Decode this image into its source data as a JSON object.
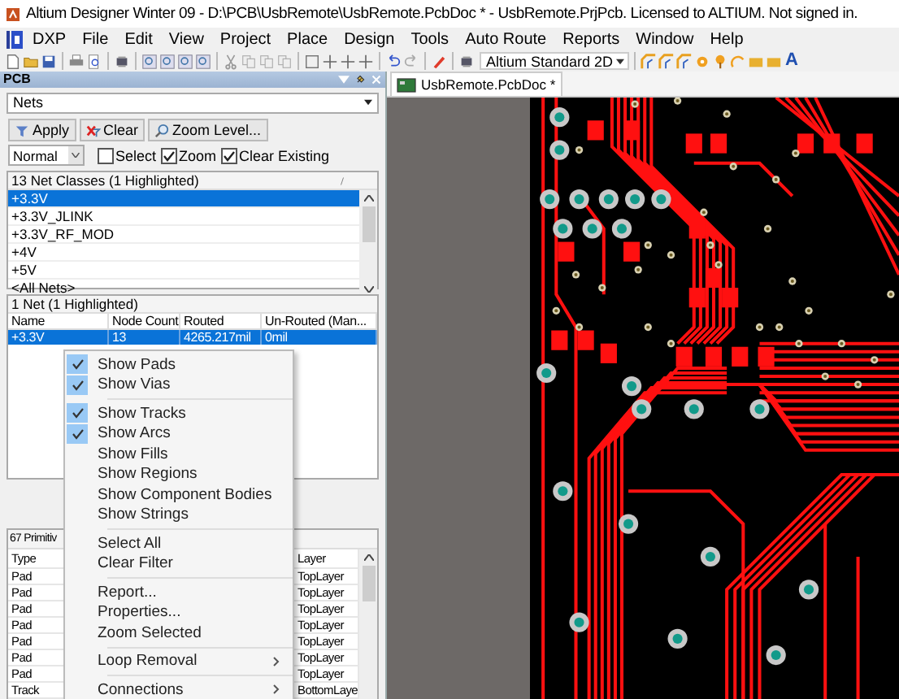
{
  "window": {
    "title": "Altium Designer Winter 09 - D:\\PCB\\UsbRemote\\UsbRemote.PcbDoc * - UsbRemote.PrjPcb. Licensed to ALTIUM. Not signed in."
  },
  "menu_bar": [
    "DXP",
    "File",
    "Edit",
    "View",
    "Project",
    "Place",
    "Design",
    "Tools",
    "Auto Route",
    "Reports",
    "Window",
    "Help"
  ],
  "toolbar": {
    "view_select": "Altium Standard 2D",
    "text_tool": "A"
  },
  "panel": {
    "title": "PCB",
    "mode": "Nets",
    "buttons": [
      "Apply",
      "Clear",
      "Zoom Level..."
    ],
    "highlight_mode": "Normal",
    "options": [
      {
        "label": "Select",
        "checked": false
      },
      {
        "label": "Zoom",
        "checked": true
      },
      {
        "label": "Clear Existing",
        "checked": true
      }
    ],
    "net_classes": {
      "header": "13 Net Classes (1 Highlighted)",
      "rows": [
        {
          "name": "+3.3V",
          "selected": true
        },
        {
          "name": "+3.3V_JLINK",
          "selected": false
        },
        {
          "name": "+3.3V_RF_MOD",
          "selected": false
        },
        {
          "name": "+4V",
          "selected": false
        },
        {
          "name": "+5V",
          "selected": false
        },
        {
          "name": "<All Nets>",
          "selected": false
        }
      ]
    },
    "nets": {
      "header": "1 Net (1 Highlighted)",
      "columns": [
        "Name",
        "Node Count",
        "Routed",
        "Un-Routed (Man..."
      ],
      "rows": [
        {
          "cells": [
            "+3.3V",
            "13",
            "4265.217mil",
            "0mil"
          ],
          "selected": true
        }
      ]
    },
    "primitives": {
      "header": "67 Primitiv",
      "columns": [
        "Type",
        "Layer"
      ],
      "rows": [
        {
          "type": "Pad",
          "layer": "TopLayer"
        },
        {
          "type": "Pad",
          "layer": "TopLayer"
        },
        {
          "type": "Pad",
          "layer": "TopLayer"
        },
        {
          "type": "Pad",
          "layer": "TopLayer"
        },
        {
          "type": "Pad",
          "layer": "TopLayer"
        },
        {
          "type": "Pad",
          "layer": "TopLayer"
        },
        {
          "type": "Pad",
          "layer": "TopLayer"
        },
        {
          "type": "Track",
          "layer": "BottomLaye"
        }
      ]
    }
  },
  "document_tab": {
    "label": "UsbRemote.PcbDoc *",
    "selected": true
  },
  "context_menu": {
    "items": [
      {
        "kind": "item",
        "label": "Show Pads",
        "checked": true,
        "submenu": false
      },
      {
        "kind": "item",
        "label": "Show Vias",
        "checked": true,
        "submenu": false
      },
      {
        "kind": "separator"
      },
      {
        "kind": "item",
        "label": "Show Tracks",
        "checked": true,
        "submenu": false
      },
      {
        "kind": "item",
        "label": "Show Arcs",
        "checked": true,
        "submenu": false
      },
      {
        "kind": "item",
        "label": "Show Fills",
        "checked": false,
        "submenu": false
      },
      {
        "kind": "item",
        "label": "Show Regions",
        "checked": false,
        "submenu": false
      },
      {
        "kind": "item",
        "label": "Show Component Bodies",
        "checked": false,
        "submenu": false
      },
      {
        "kind": "item",
        "label": "Show Strings",
        "checked": false,
        "submenu": false
      },
      {
        "kind": "separator"
      },
      {
        "kind": "item",
        "label": "Select All",
        "checked": false,
        "submenu": false
      },
      {
        "kind": "item",
        "label": "Clear Filter",
        "checked": false,
        "submenu": false
      },
      {
        "kind": "separator"
      },
      {
        "kind": "item",
        "label": "Report...",
        "checked": false,
        "submenu": false
      },
      {
        "kind": "item",
        "label": "Properties...",
        "checked": false,
        "submenu": false
      },
      {
        "kind": "item",
        "label": "Zoom Selected",
        "checked": false,
        "submenu": false
      },
      {
        "kind": "separator"
      },
      {
        "kind": "item",
        "label": "Loop Removal",
        "checked": false,
        "submenu": true
      },
      {
        "kind": "separator"
      },
      {
        "kind": "item",
        "label": "Connections",
        "checked": false,
        "submenu": true
      }
    ]
  }
}
